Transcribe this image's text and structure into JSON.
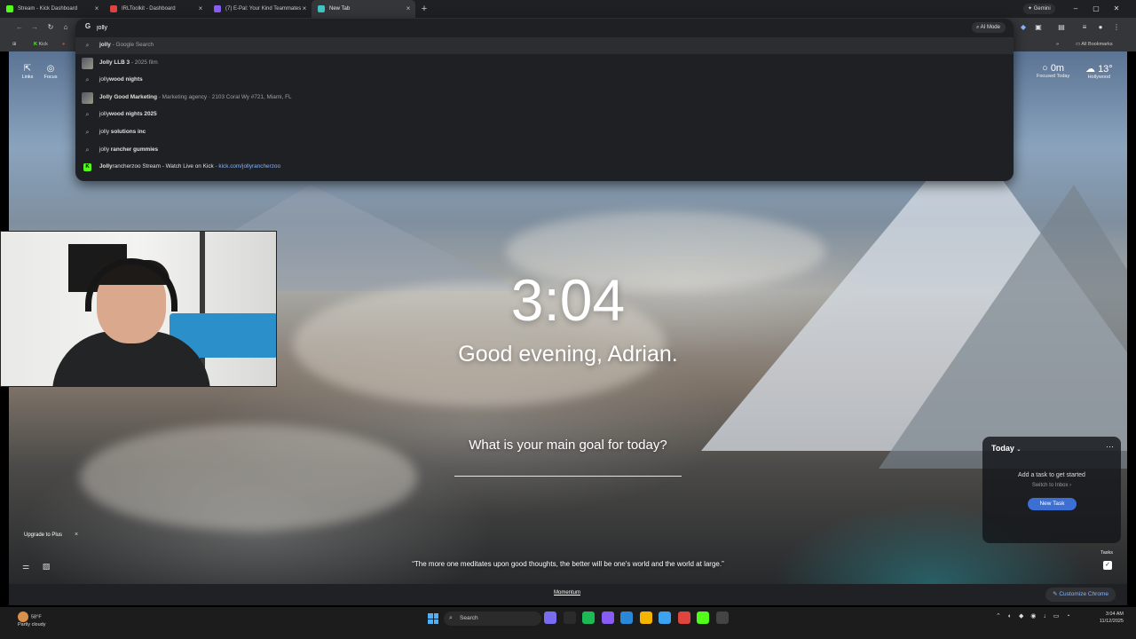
{
  "tabs": [
    {
      "title": "Stream - Kick Dashboard",
      "favicon_color": "#53fc18",
      "active": false
    },
    {
      "title": "IRLToolkit - Dashboard",
      "favicon_color": "#e0443f",
      "active": false
    },
    {
      "title": "(7) E-Pal: Your Kind Teammates",
      "favicon_color": "#8a5cf6",
      "active": false
    },
    {
      "title": "New Tab",
      "favicon_color": "#3ec7c2",
      "active": true
    }
  ],
  "gemini_label": "Gemini",
  "omnibox": {
    "value": "jolly",
    "ai_mode_label": "AI Mode",
    "suggestions": [
      {
        "kind": "search",
        "bold": "jolly",
        "sub": " - Google Search",
        "url": ""
      },
      {
        "kind": "entity",
        "bold": "Jolly LLB 3",
        "sub": " - 2025 film",
        "url": ""
      },
      {
        "kind": "search",
        "plain": "jolly",
        "bold": "wood nights",
        "sub": "",
        "url": ""
      },
      {
        "kind": "entity",
        "bold": "Jolly Good Marketing",
        "sub": " - Marketing agency · 2103 Coral Wy #721, Miami, FL",
        "url": ""
      },
      {
        "kind": "search",
        "plain": "jolly",
        "bold": "wood nights 2025",
        "sub": "",
        "url": ""
      },
      {
        "kind": "search",
        "plain": "jolly ",
        "bold": "solutions inc",
        "sub": "",
        "url": ""
      },
      {
        "kind": "search",
        "plain": "jolly ",
        "bold": "rancher gummies",
        "sub": "",
        "url": ""
      },
      {
        "kind": "site",
        "bold": "Jolly",
        "plain_after": "rancherzoo Stream - Watch Live on Kick",
        "sub": " - ",
        "url": "kick.com/jollyrancherzoo"
      }
    ]
  },
  "bookmarks": {
    "kick_label": "Kick",
    "all_bookmarks_label": "All Bookmarks"
  },
  "momentum": {
    "links_label": "Links",
    "focus_label": "Focus",
    "focused_value": "0m",
    "focused_label": "Focused Today",
    "temperature": "13°",
    "location": "Hollywood",
    "clock": "3:04",
    "greeting": "Good evening, Adrian.",
    "goal_question": "What is your main goal for today?",
    "quote": "“The more one meditates upon good thoughts, the better will be one's world and the world at large.”",
    "upgrade_label": "Upgrade to Plus",
    "todo": {
      "title": "Today",
      "hint": "Add a task to get started",
      "inbox_link": "Switch to Inbox ›",
      "new_task_label": "New Task"
    },
    "tasks_label": "Tasks",
    "footer_link": "Momentum"
  },
  "chrome_footer": {
    "customize_label": "Customize Chrome"
  },
  "taskbar": {
    "weather_temp": "58°F",
    "weather_desc": "Partly cloudy",
    "search_label": "Search",
    "time": "3:04 AM",
    "date": "11/12/2025",
    "app_colors": [
      "#7a6cf0",
      "#2b2b2b",
      "#1db954",
      "#8a5cf6",
      "#2b88d8",
      "#f4b400",
      "#3ba3f0",
      "#e0443f",
      "#53fc18",
      "#444444"
    ]
  }
}
